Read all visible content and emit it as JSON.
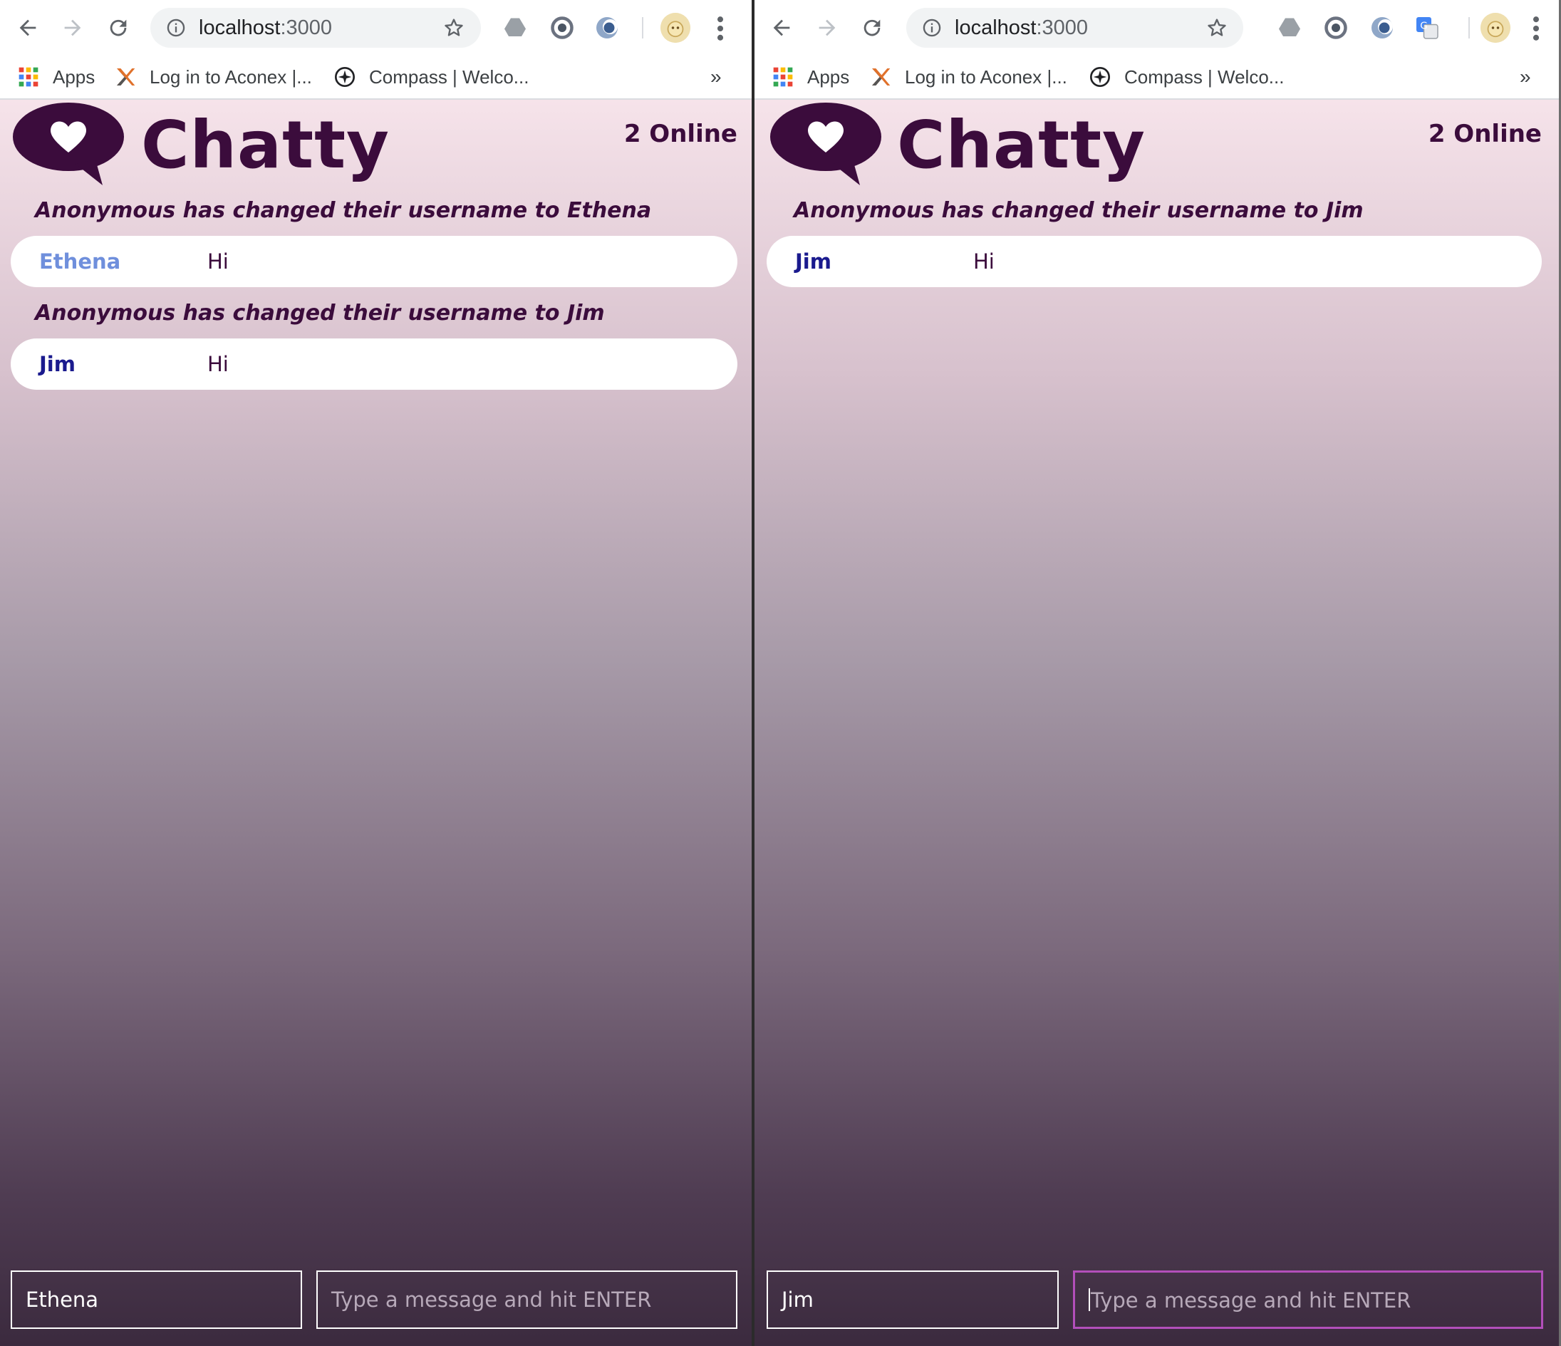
{
  "windows": [
    {
      "browser": {
        "url_host": "localhost",
        "url_port": ":3000",
        "bookmarks": {
          "apps_label": "Apps",
          "aconex_label": "Log in to Aconex |...",
          "compass_label": "Compass | Welco...",
          "more_label": "»"
        }
      },
      "app": {
        "brand": "Chatty",
        "online": "2 Online",
        "messages": [
          {
            "system": "Anonymous has changed their username to Ethena"
          },
          {
            "user": "Ethena",
            "content": "Hi",
            "user_color": "#6f8fdc"
          },
          {
            "system": "Anonymous has changed their username to Jim"
          },
          {
            "user": "Jim",
            "content": "Hi",
            "user_color": "#1a1a8e"
          }
        ],
        "chatbar": {
          "username": "Ethena",
          "message_placeholder": "Type a message and hit ENTER"
        }
      }
    },
    {
      "browser": {
        "url_host": "localhost",
        "url_port": ":3000",
        "bookmarks": {
          "apps_label": "Apps",
          "aconex_label": "Log in to Aconex |...",
          "compass_label": "Compass | Welco...",
          "more_label": "»"
        }
      },
      "app": {
        "brand": "Chatty",
        "online": "2 Online",
        "messages": [
          {
            "system": "Anonymous has changed their username to Jim"
          },
          {
            "user": "Jim",
            "content": "Hi",
            "user_color": "#1a1a8e"
          }
        ],
        "chatbar": {
          "username": "Jim",
          "message_placeholder": "Type a message and hit ENTER"
        }
      }
    }
  ],
  "colors": {
    "brand": "#3b0c3c",
    "focus_border": "#b24fba"
  }
}
